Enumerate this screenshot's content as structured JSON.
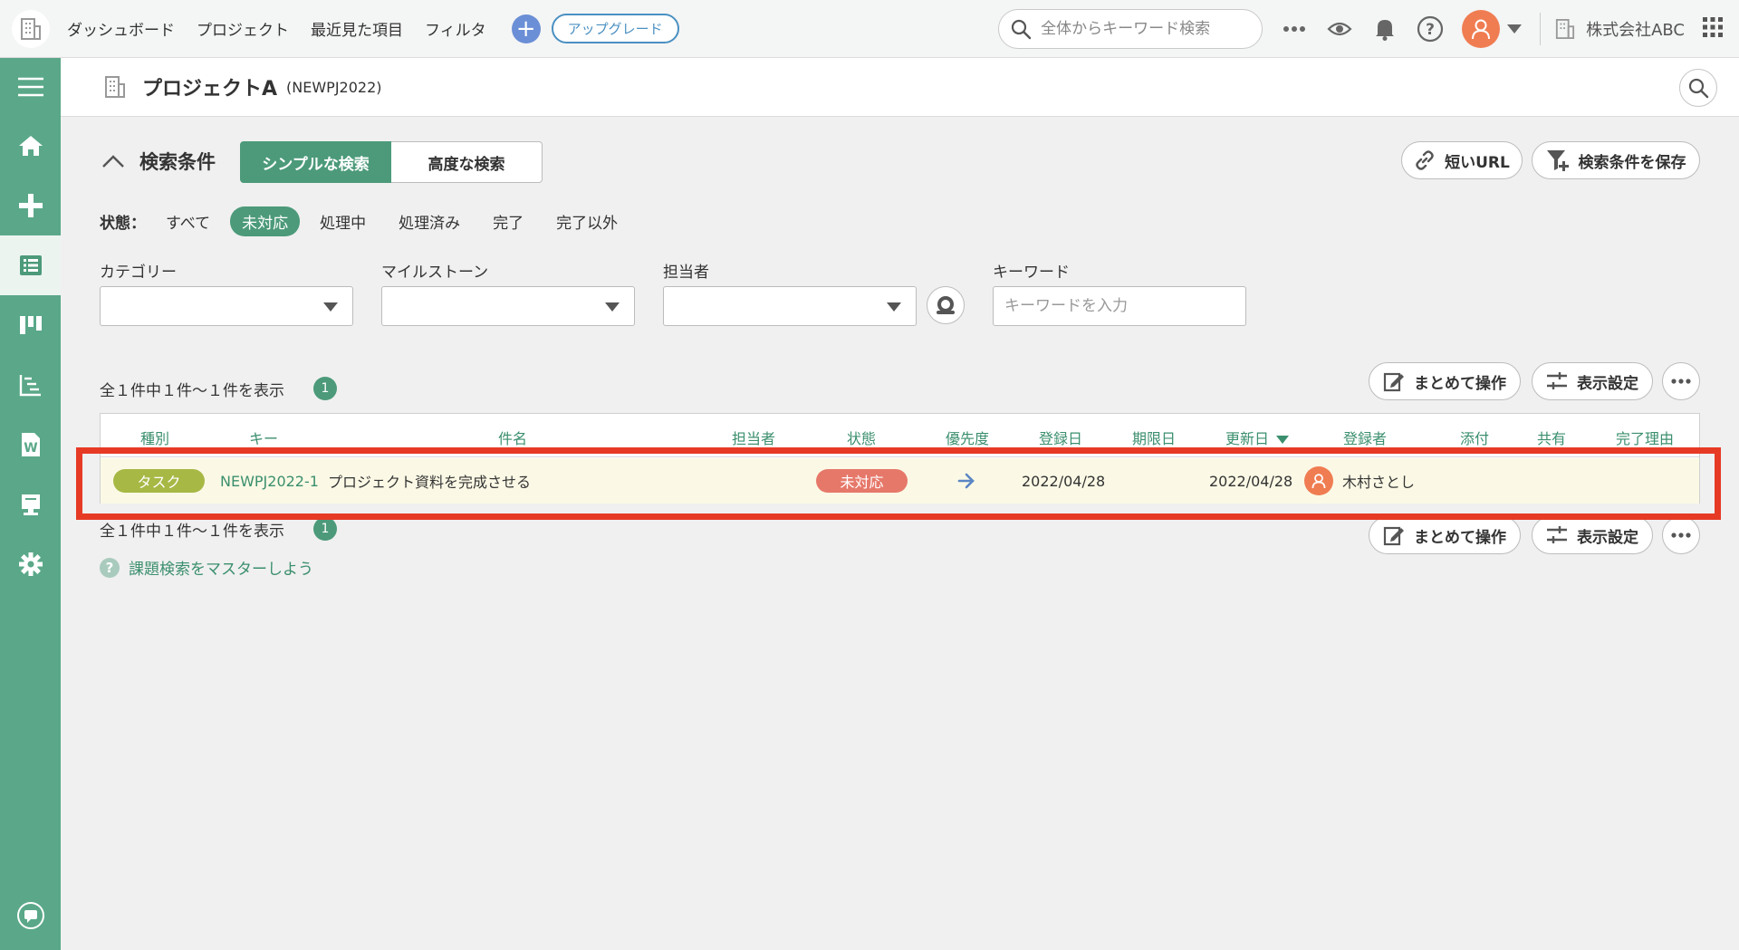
{
  "topbar": {
    "nav": [
      "ダッシュボード",
      "プロジェクト",
      "最近見た項目",
      "フィルタ"
    ],
    "plus_label": "+",
    "upgrade_label": "アップグレード",
    "search_placeholder": "全体からキーワード検索",
    "company": "株式会社ABC",
    "icons": [
      "building-icon",
      "plus-icon",
      "search-icon",
      "more-horizontal-icon",
      "eye-icon",
      "bell-icon",
      "help-icon",
      "user-avatar-icon",
      "chevron-down-icon",
      "building-icon",
      "apps-grid-icon"
    ]
  },
  "sidebar": {
    "icons": [
      "menu-icon",
      "home-icon",
      "add-issue-icon",
      "issue-list-icon",
      "board-icon",
      "gantt-icon",
      "wiki-icon",
      "files-icon",
      "settings-icon"
    ],
    "active": "issue-list-icon",
    "bottom_icon": "chat-icon"
  },
  "project": {
    "title": "プロジェクトA",
    "key": "(NEWPJ2022)"
  },
  "search": {
    "heading": "検索条件",
    "simple_label": "シンプルな検索",
    "advanced_label": "高度な検索",
    "short_url_label": "短いURL",
    "save_label": "検索条件を保存",
    "status_label": "状態：",
    "status_options": [
      "すべて",
      "未対応",
      "処理中",
      "処理済み",
      "完了",
      "完了以外"
    ],
    "status_selected": "未対応",
    "category_label": "カテゴリー",
    "milestone_label": "マイルストーン",
    "assignee_label": "担当者",
    "keyword_label": "キーワード",
    "keyword_placeholder": "キーワードを入力"
  },
  "results": {
    "count_text": "全１件中１件〜１件を表示",
    "count_badge": "1",
    "bulk_label": "まとめて操作",
    "display_label": "表示設定"
  },
  "table": {
    "headers": [
      "種別",
      "キー",
      "件名",
      "担当者",
      "状態",
      "優先度",
      "登録日",
      "期限日",
      "更新日",
      "登録者",
      "添付",
      "共有",
      "完了理由"
    ],
    "sorted_column": "更新日",
    "rows": [
      {
        "type": "タスク",
        "key": "NEWPJ2022-1",
        "subject": "プロジェクト資料を完成させる",
        "assignee": "",
        "status": "未対応",
        "priority_icon": "arrow-right-icon",
        "created": "2022/04/28",
        "due": "",
        "updated": "2022/04/28",
        "registrant": "木村さとし"
      }
    ]
  },
  "help": {
    "label": "課題検索をマスターしよう"
  },
  "colors": {
    "sidebar": "#5aa889",
    "accent": "#4c9a7a",
    "type_task": "#a7b845",
    "status_open": "#e6786a",
    "highlight": "#e63a25"
  }
}
